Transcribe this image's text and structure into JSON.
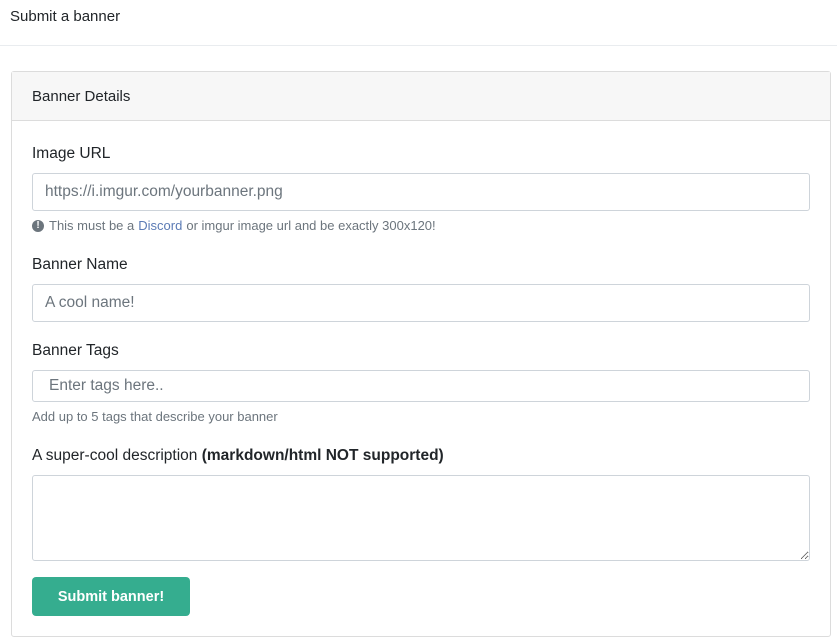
{
  "page": {
    "title": "Submit a banner"
  },
  "card": {
    "header": "Banner Details",
    "image_url": {
      "label": "Image URL",
      "placeholder": "https://i.imgur.com/yourbanner.png",
      "help_prefix": "This must be a",
      "help_link": "Discord",
      "help_suffix": "or imgur image url and be exactly 300x120!",
      "help_icon": "exclamation-circle-icon"
    },
    "banner_name": {
      "label": "Banner Name",
      "placeholder": "A cool name!"
    },
    "banner_tags": {
      "label": "Banner Tags",
      "placeholder": "Enter tags here..",
      "help": "Add up to 5 tags that describe your banner"
    },
    "description": {
      "label_prefix": "A super-cool description",
      "label_bold": "(markdown/html NOT supported)",
      "value": ""
    },
    "submit_label": "Submit banner!"
  },
  "colors": {
    "submit_button": "#35ad8f",
    "link": "#5b7bb5"
  }
}
